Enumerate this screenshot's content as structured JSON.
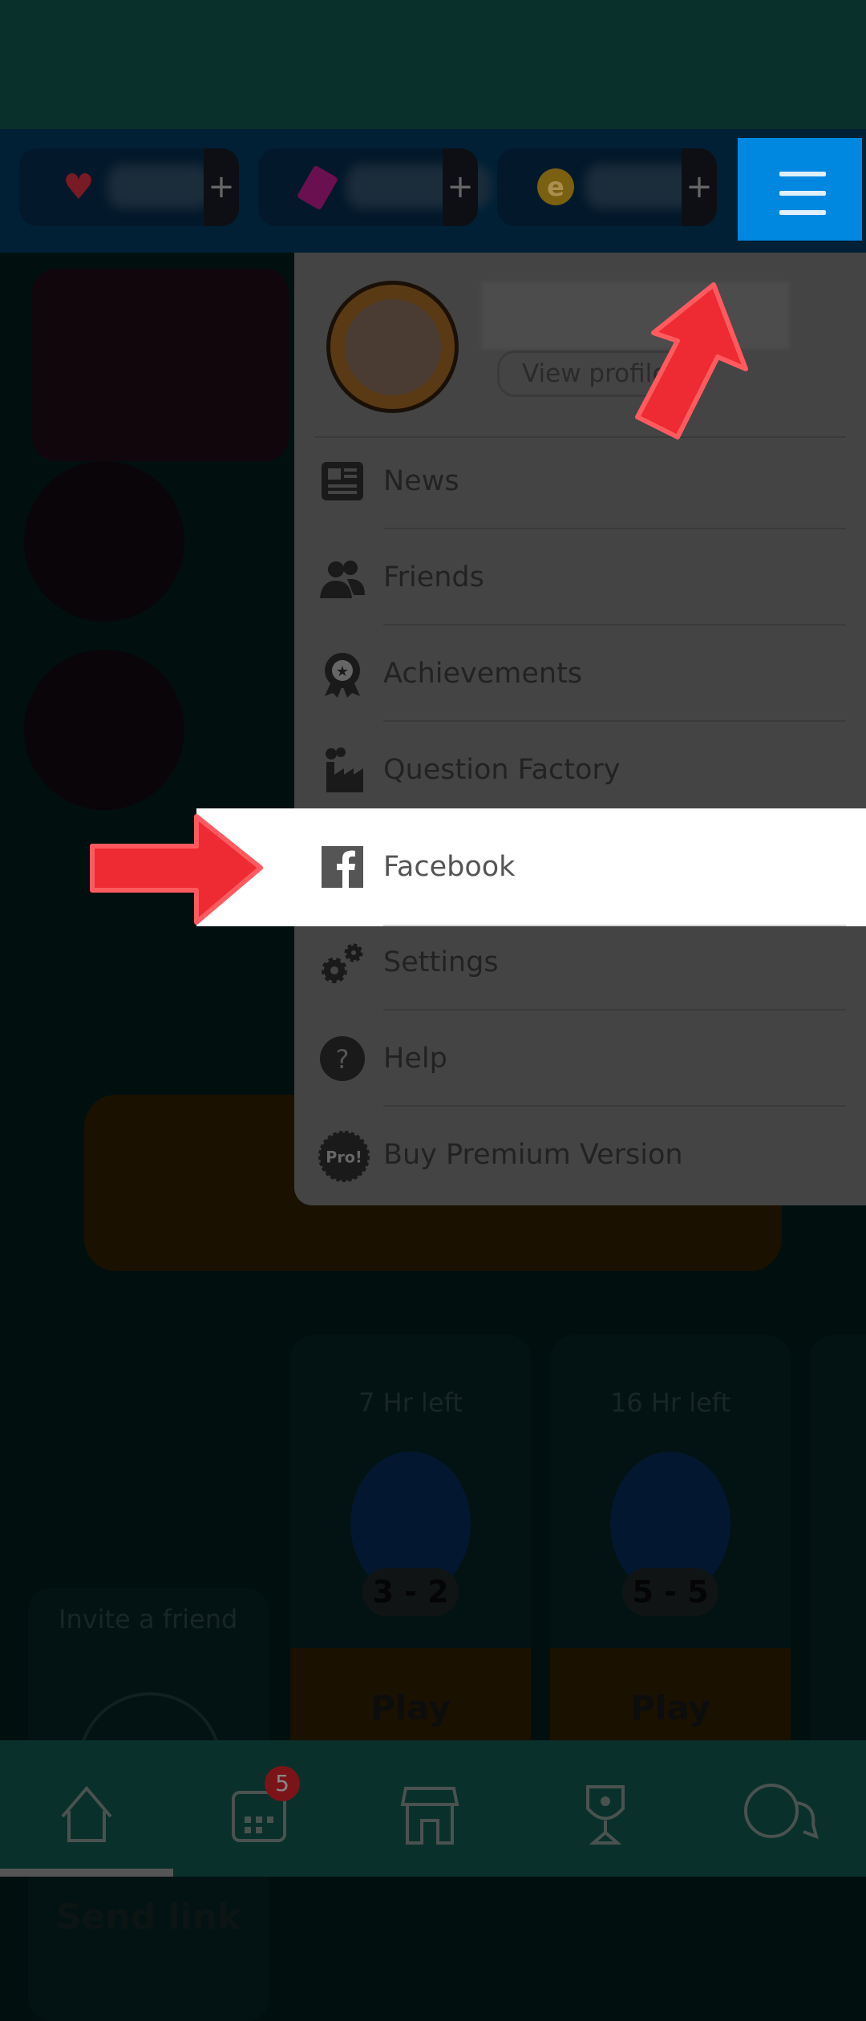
{
  "topbar": {
    "resources": [
      {
        "icon": "heart-icon",
        "color": "#7a1a24"
      },
      {
        "icon": "ticket-icon",
        "color": "#6a1050"
      },
      {
        "icon": "coin-icon",
        "color": "#7a6010",
        "glyph": "e"
      }
    ],
    "plus_label": "+",
    "menu_button_color": "#0088e0"
  },
  "profile": {
    "view_profile_label": "View profile"
  },
  "menu": {
    "items": [
      {
        "label": "News",
        "icon": "newspaper-icon"
      },
      {
        "label": "Friends",
        "icon": "friends-icon"
      },
      {
        "label": "Achievements",
        "icon": "medal-icon"
      },
      {
        "label": "Question Factory",
        "icon": "factory-icon"
      },
      {
        "label": "Facebook",
        "icon": "facebook-icon",
        "highlighted": true
      },
      {
        "label": "Settings",
        "icon": "gears-icon"
      },
      {
        "label": "Help",
        "icon": "help-icon",
        "glyph": "?"
      },
      {
        "label": "Buy Premium Version",
        "icon": "pro-badge-icon",
        "glyph": "Pro!"
      }
    ]
  },
  "background": {
    "invite_label": "Invite a friend",
    "send_link_label": "Send link",
    "games": [
      {
        "time_left": "7 Hr left",
        "score": "3 - 2",
        "play_label": "Play"
      },
      {
        "time_left": "16 Hr left",
        "score": "5 - 5",
        "play_label": "Play"
      }
    ]
  },
  "nav": {
    "items": [
      "home-icon",
      "calendar-icon",
      "shop-icon",
      "trophy-icon",
      "chat-icon"
    ],
    "calendar_badge": "5"
  },
  "annotation_color": "#ee2a33"
}
